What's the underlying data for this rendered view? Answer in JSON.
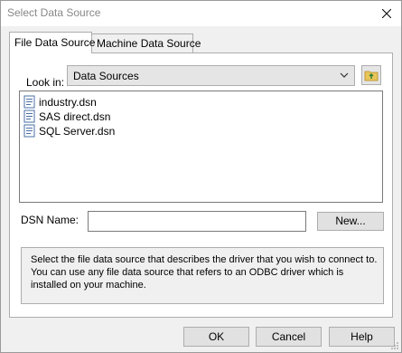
{
  "window": {
    "title": "Select Data Source"
  },
  "tabs": [
    {
      "label": "File Data Source",
      "active": true
    },
    {
      "label": "Machine Data Source",
      "active": false
    }
  ],
  "look_in": {
    "label": "Look in:",
    "value": "Data Sources"
  },
  "files": [
    {
      "name": "industry.dsn",
      "icon": "dsn-file-icon"
    },
    {
      "name": "SAS direct.dsn",
      "icon": "dsn-file-icon"
    },
    {
      "name": "SQL Server.dsn",
      "icon": "dsn-file-icon"
    }
  ],
  "dsn": {
    "label": "DSN Name:",
    "value": "",
    "new_label": "New..."
  },
  "description": "Select the file data source that describes the driver that you wish to connect to. You can use any file data source that refers to an ODBC driver which is installed on your machine.",
  "buttons": {
    "ok": "OK",
    "cancel": "Cancel",
    "help": "Help"
  }
}
